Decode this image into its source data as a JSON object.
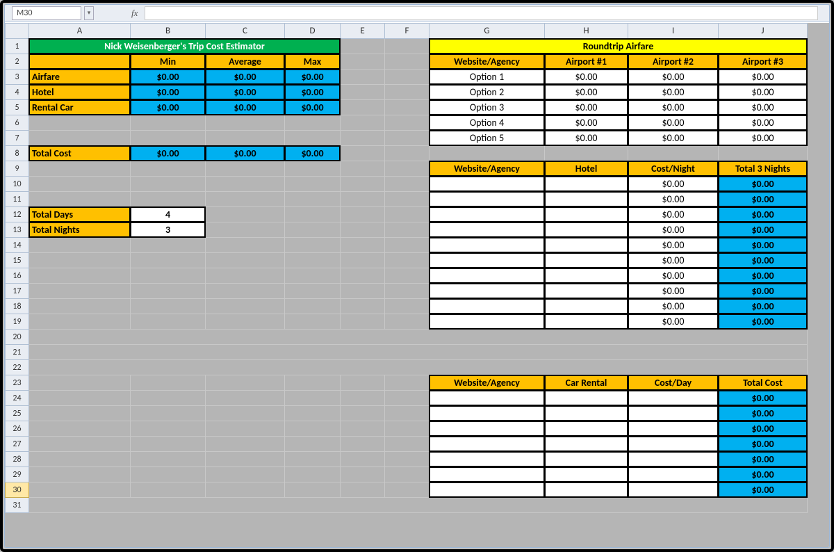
{
  "namebox": "M30",
  "columns": [
    "A",
    "B",
    "C",
    "D",
    "E",
    "F",
    "G",
    "H",
    "I",
    "J"
  ],
  "title1": "Nick Weisenberger's Trip Cost Estimator",
  "summary_headers": [
    "Min",
    "Average",
    "Max"
  ],
  "summary_rows": [
    {
      "label": "Airfare",
      "min": "$0.00",
      "avg": "$0.00",
      "max": "$0.00"
    },
    {
      "label": "Hotel",
      "min": "$0.00",
      "avg": "$0.00",
      "max": "$0.00"
    },
    {
      "label": "Rental Car",
      "min": "$0.00",
      "avg": "$0.00",
      "max": "$0.00"
    }
  ],
  "total_cost_label": "Total Cost",
  "totals": {
    "min": "$0.00",
    "avg": "$0.00",
    "max": "$0.00"
  },
  "days": {
    "label": "Total Days",
    "value": "4"
  },
  "nights": {
    "label": "Total Nights",
    "value": "3"
  },
  "airfare_title": "Roundtrip Airfare",
  "airfare_headers": [
    "Website/Agency",
    "Airport #1",
    "Airport #2",
    "Airport #3"
  ],
  "airfare_rows": [
    {
      "agency": "Option 1",
      "a": "$0.00",
      "b": "$0.00",
      "c": "$0.00"
    },
    {
      "agency": "Option 2",
      "a": "$0.00",
      "b": "$0.00",
      "c": "$0.00"
    },
    {
      "agency": "Option 3",
      "a": "$0.00",
      "b": "$0.00",
      "c": "$0.00"
    },
    {
      "agency": "Option 4",
      "a": "$0.00",
      "b": "$0.00",
      "c": "$0.00"
    },
    {
      "agency": "Option 5",
      "a": "$0.00",
      "b": "$0.00",
      "c": "$0.00"
    }
  ],
  "hotel_headers": [
    "Website/Agency",
    "Hotel",
    "Cost/Night",
    "Total 3 Nights"
  ],
  "hotel_rows": [
    {
      "cost": "$0.00",
      "total": "$0.00"
    },
    {
      "cost": "$0.00",
      "total": "$0.00"
    },
    {
      "cost": "$0.00",
      "total": "$0.00"
    },
    {
      "cost": "$0.00",
      "total": "$0.00"
    },
    {
      "cost": "$0.00",
      "total": "$0.00"
    },
    {
      "cost": "$0.00",
      "total": "$0.00"
    },
    {
      "cost": "$0.00",
      "total": "$0.00"
    },
    {
      "cost": "$0.00",
      "total": "$0.00"
    },
    {
      "cost": "$0.00",
      "total": "$0.00"
    },
    {
      "cost": "$0.00",
      "total": "$0.00"
    }
  ],
  "car_headers": [
    "Website/Agency",
    "Car Rental",
    "Cost/Day",
    "Total Cost"
  ],
  "car_rows": [
    {
      "total": "$0.00"
    },
    {
      "total": "$0.00"
    },
    {
      "total": "$0.00"
    },
    {
      "total": "$0.00"
    },
    {
      "total": "$0.00"
    },
    {
      "total": "$0.00"
    },
    {
      "total": "$0.00"
    }
  ]
}
